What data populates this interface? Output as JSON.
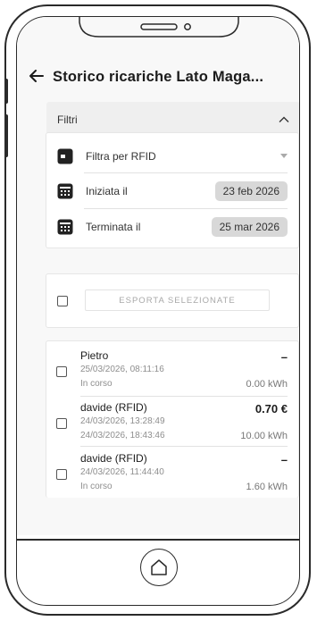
{
  "header": {
    "back_icon": "arrow-left-icon",
    "title": "Storico ricariche Lato Maga..."
  },
  "filters": {
    "label": "Filtri",
    "toggle_icon": "chevron-up-icon",
    "rfid": {
      "label": "Filtra per RFID",
      "icon": "card-icon",
      "dropdown_icon": "caret-down-icon"
    },
    "start": {
      "label": "Iniziata il",
      "value": "23 feb 2026",
      "icon": "calendar-icon"
    },
    "end": {
      "label": "Terminata il",
      "value": "25 mar 2026",
      "icon": "calendar-icon"
    }
  },
  "export": {
    "button_label": "ESPORTA SELEZIONATE"
  },
  "sessions": [
    {
      "name": "Pietro",
      "start": "25/03/2026, 08:11:16",
      "end": "In corso",
      "amount": "–",
      "energy": "0.00 kWh"
    },
    {
      "name": "davide (RFID)",
      "start": "24/03/2026, 13:28:49",
      "end": "24/03/2026, 18:43:46",
      "amount": "0.70 €",
      "energy": "10.00 kWh"
    },
    {
      "name": "davide (RFID)",
      "start": "24/03/2026, 11:44:40",
      "end": "In corso",
      "amount": "–",
      "energy": "1.60 kWh"
    }
  ],
  "home_icon": "home-icon",
  "colors": {
    "pill_bg": "#d8d8d8",
    "screen_bg": "#f8f8f8",
    "icon_dark": "#222222"
  }
}
